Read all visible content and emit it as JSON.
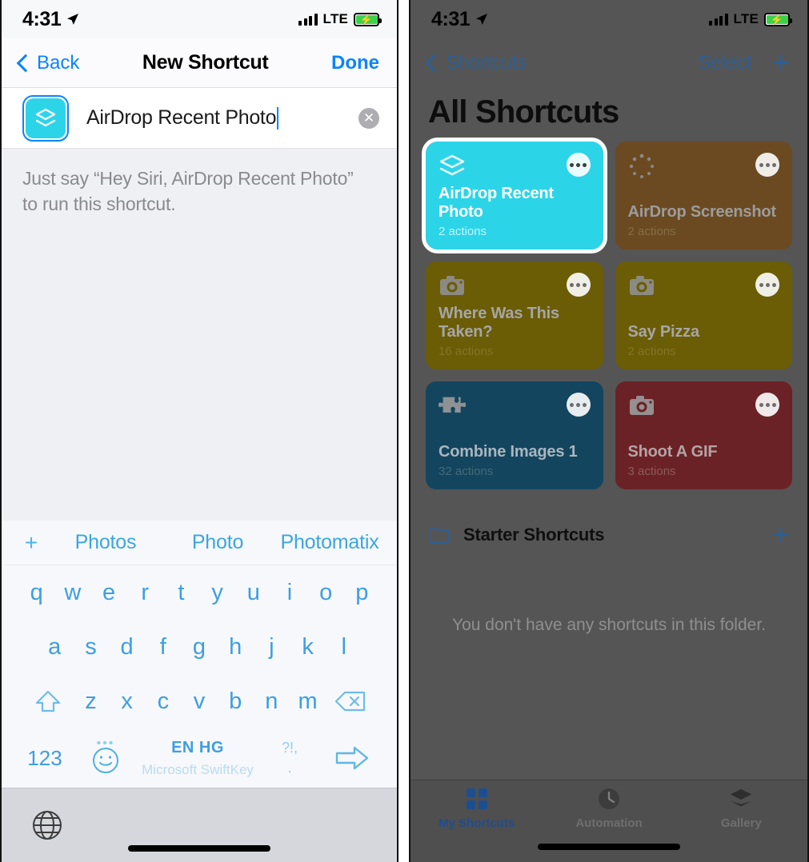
{
  "left": {
    "status": {
      "time": "4:31",
      "carrier": "LTE",
      "location_icon": "location-arrow-icon",
      "battery_icon": "battery-charging-icon"
    },
    "nav": {
      "back_label": "Back",
      "title": "New Shortcut",
      "done_label": "Done"
    },
    "name_field": {
      "value": "AirDrop Recent Photo",
      "icon_name": "shortcuts-layers-icon",
      "icon_color": "#2cd4e8",
      "clear_label": "✕"
    },
    "description": "Just say “Hey Siri, AirDrop Recent Photo” to run this shortcut.",
    "keyboard": {
      "suggestions": [
        "Photos",
        "Photo",
        "Photomatix"
      ],
      "add_label": "+",
      "row1": [
        "q",
        "w",
        "e",
        "r",
        "t",
        "y",
        "u",
        "i",
        "o",
        "p"
      ],
      "row2": [
        "a",
        "s",
        "d",
        "f",
        "g",
        "h",
        "j",
        "k",
        "l"
      ],
      "row3": [
        "z",
        "x",
        "c",
        "v",
        "b",
        "n",
        "m"
      ],
      "shift_icon": "shift-up-arrow-icon",
      "delete_icon": "backspace-icon",
      "numeric_label": "123",
      "emoji_icon": "emoji-smiley-icon",
      "space_lang": "EN HG",
      "space_brand": "Microsoft SwiftKey",
      "punct_top": "?!,",
      "punct_bottom": ".",
      "enter_icon": "enter-arrow-icon",
      "globe_icon": "globe-icon"
    }
  },
  "right": {
    "status": {
      "time": "4:31",
      "carrier": "LTE"
    },
    "nav": {
      "back_label": "Shortcuts",
      "select_label": "Select",
      "add_label": "+"
    },
    "title": "All Shortcuts",
    "cards": [
      {
        "title": "AirDrop Recent Photo",
        "actions": "2 actions",
        "color": "#2cd4e8",
        "icon": "shortcuts-layers-icon",
        "selected": true
      },
      {
        "title": "AirDrop Screenshot",
        "actions": "2 actions",
        "color": "#6b4a21",
        "icon": "loading-spinner-icon",
        "selected": false
      },
      {
        "title": "Where Was This Taken?",
        "actions": "16 actions",
        "color": "#6b5c06",
        "icon": "camera-icon",
        "selected": false
      },
      {
        "title": "Say Pizza",
        "actions": "2 actions",
        "color": "#6b5c06",
        "icon": "camera-icon",
        "selected": false
      },
      {
        "title": "Combine Images 1",
        "actions": "32 actions",
        "color": "#13455f",
        "icon": "puzzle-piece-icon",
        "selected": false
      },
      {
        "title": "Shoot A GIF",
        "actions": "3 actions",
        "color": "#6b2226",
        "icon": "camera-icon",
        "selected": false
      }
    ],
    "folder": {
      "name": "Starter Shortcuts",
      "icon": "folder-icon",
      "add_label": "+"
    },
    "empty_message": "You don't have any shortcuts in this folder.",
    "tabs": [
      {
        "label": "My Shortcuts",
        "icon": "grid-squares-icon",
        "active": true
      },
      {
        "label": "Automation",
        "icon": "clock-icon",
        "active": false
      },
      {
        "label": "Gallery",
        "icon": "layers-icon",
        "active": false
      }
    ]
  }
}
